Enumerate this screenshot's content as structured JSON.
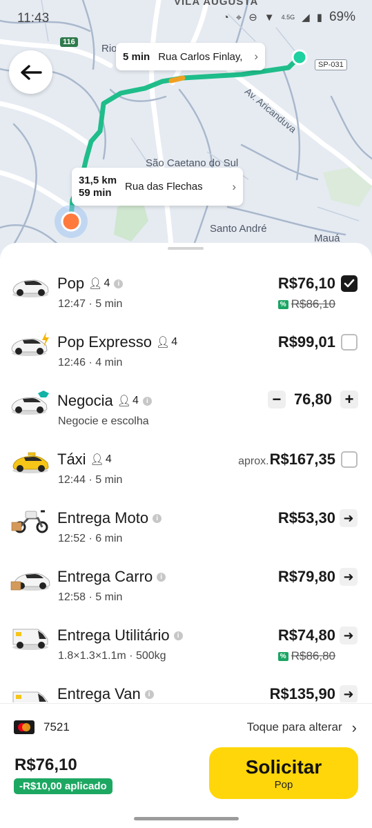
{
  "status_bar": {
    "time": "11:43",
    "network": "4.5G",
    "battery": "69%"
  },
  "map": {
    "labels": {
      "top_area": "VILA AUGUSTA",
      "partial_left": "Rio",
      "avenue": "Av. Aricanduva",
      "city1": "São Caetano do Sul",
      "city2": "Santo André",
      "city3": "Mauá"
    },
    "badges": {
      "highway": "116",
      "road": "SP-031"
    },
    "callout_top": {
      "time": "5 min",
      "street": "Rua Carlos Finlay,"
    },
    "callout_bottom": {
      "distance": "31,5 km",
      "duration": "59 min",
      "street": "Rua das Flechas"
    }
  },
  "rides": [
    {
      "name": "Pop",
      "seats": "4",
      "sub": "12:47 · 5 min",
      "price": "R$76,10",
      "old_price": "R$86,10",
      "control": "checkbox-checked"
    },
    {
      "name": "Pop Expresso",
      "seats": "4",
      "sub": "12:46 · 4 min",
      "price": "R$99,01",
      "control": "checkbox"
    },
    {
      "name": "Negocia",
      "seats": "4",
      "sub": "Negocie e escolha",
      "price": "76,80",
      "control": "stepper",
      "minus": "−",
      "plus": "+"
    },
    {
      "name": "Táxi",
      "seats": "4",
      "sub": "12:44 · 5 min",
      "price": "R$167,35",
      "prefix": "aprox.",
      "control": "checkbox"
    },
    {
      "name": "Entrega Moto",
      "sub": "12:52 · 6 min",
      "price": "R$53,30",
      "control": "arrow"
    },
    {
      "name": "Entrega Carro",
      "sub": "12:58 · 5 min",
      "price": "R$79,80",
      "control": "arrow"
    },
    {
      "name": "Entrega Utilitário",
      "sub": "1.8×1.3×1.1m · 500kg",
      "price": "R$74,80",
      "old_price": "R$86,80",
      "control": "arrow"
    },
    {
      "name": "Entrega Van",
      "sub": "",
      "price": "R$135,90",
      "control": "arrow"
    }
  ],
  "payment": {
    "card_last4": "7521",
    "change_label": "Toque para alterar"
  },
  "footer": {
    "total": "R$76,10",
    "discount": "-R$10,00 aplicado",
    "request_label": "Solicitar",
    "request_sub": "Pop"
  },
  "colors": {
    "accent": "#ffd60a",
    "route": "#1fbd8a",
    "promo": "#1da862"
  }
}
